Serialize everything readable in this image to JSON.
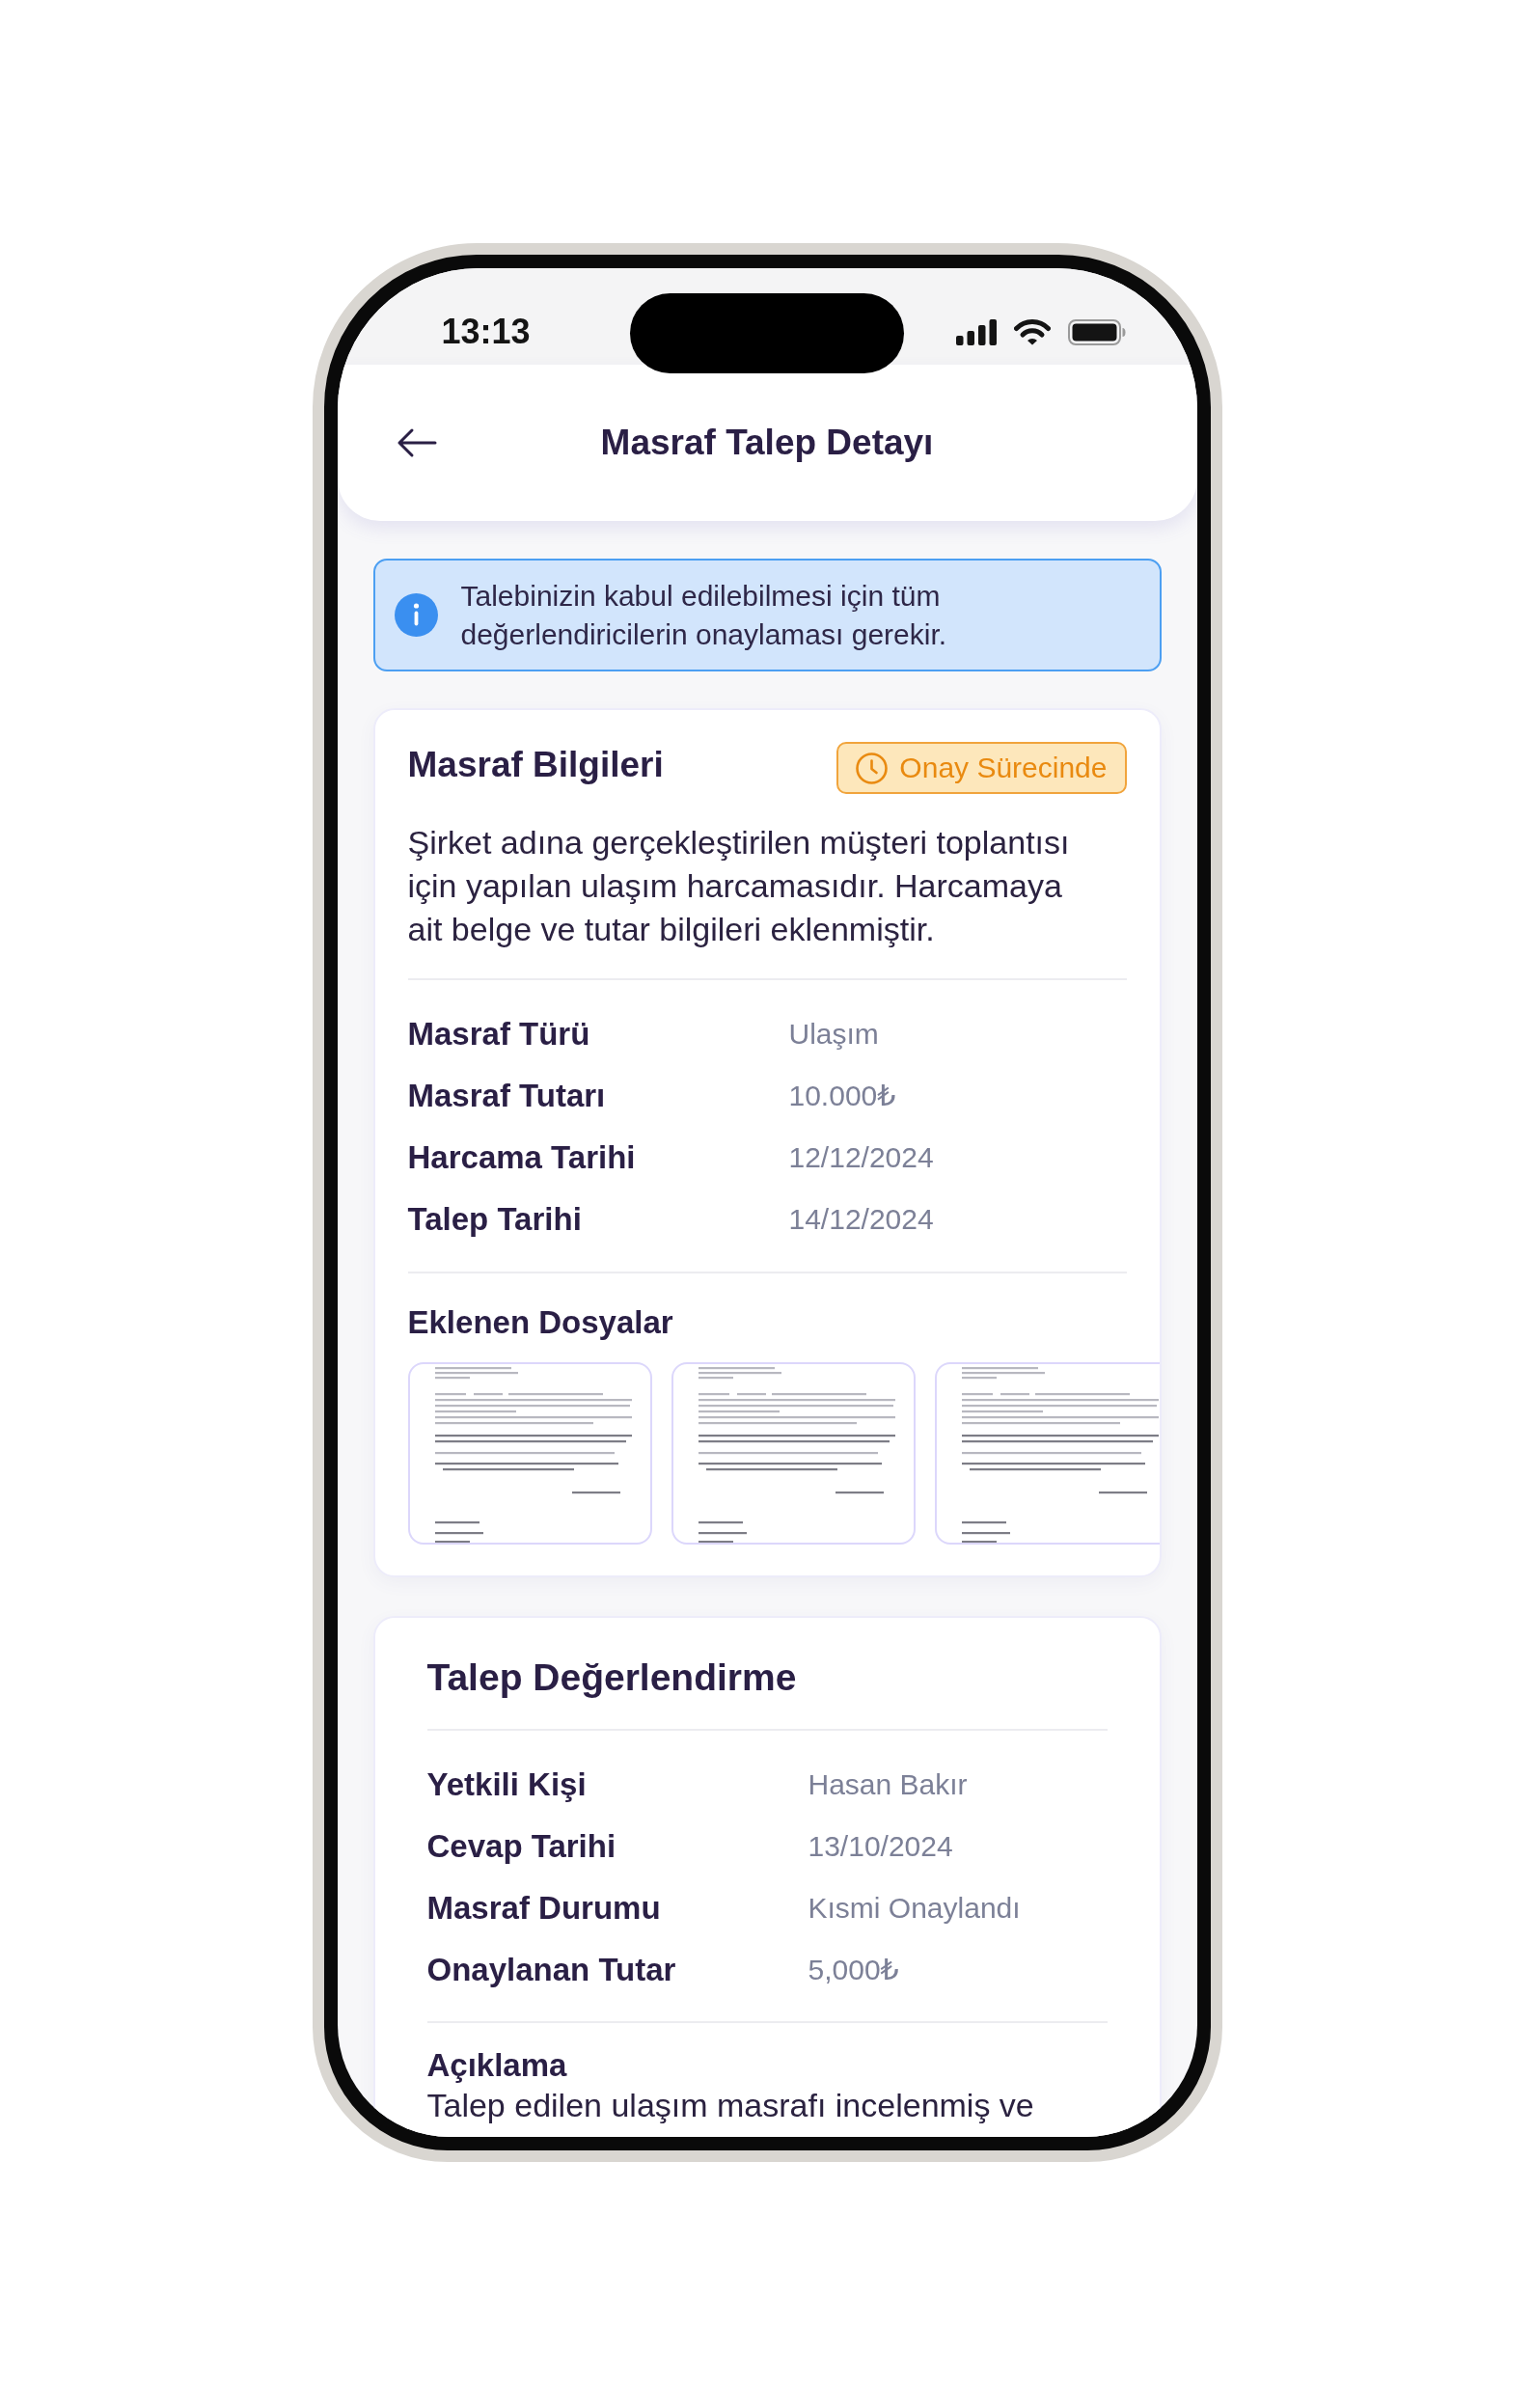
{
  "status_bar": {
    "time": "13:13"
  },
  "header": {
    "title": "Masraf Talep Detayı"
  },
  "info_banner": {
    "text": "Talebinizin kabul edilebilmesi için tüm değerlendiricilerin onaylaması gerekir."
  },
  "expense_card": {
    "title": "Masraf Bilgileri",
    "status": "Onay Sürecinde",
    "description": "Şirket adına gerçekleştirilen müşteri toplantısı için yapılan ulaşım harcamasıdır. Harcamaya ait belge ve tutar bilgileri eklenmiştir.",
    "details": [
      {
        "label": "Masraf Türü",
        "value": "Ulaşım"
      },
      {
        "label": "Masraf Tutarı",
        "value": "10.000₺"
      },
      {
        "label": "Harcama Tarihi",
        "value": "12/12/2024"
      },
      {
        "label": "Talep Tarihi",
        "value": "14/12/2024"
      }
    ],
    "files_title": "Eklenen Dosyalar",
    "files": [
      {
        "kind": "document"
      },
      {
        "kind": "document"
      },
      {
        "kind": "document"
      }
    ]
  },
  "evaluation_card": {
    "title": "Talep Değerlendirme",
    "details": [
      {
        "label": "Yetkili Kişi",
        "value": "Hasan Bakır"
      },
      {
        "label": "Cevap Tarihi",
        "value": "13/10/2024"
      },
      {
        "label": "Masraf Durumu",
        "value": "Kısmi Onaylandı"
      },
      {
        "label": "Onaylanan Tutar",
        "value": "5,000₺"
      }
    ],
    "note_title": "Açıklama",
    "note": "Talep edilen ulaşım masrafı incelenmiş ve"
  }
}
